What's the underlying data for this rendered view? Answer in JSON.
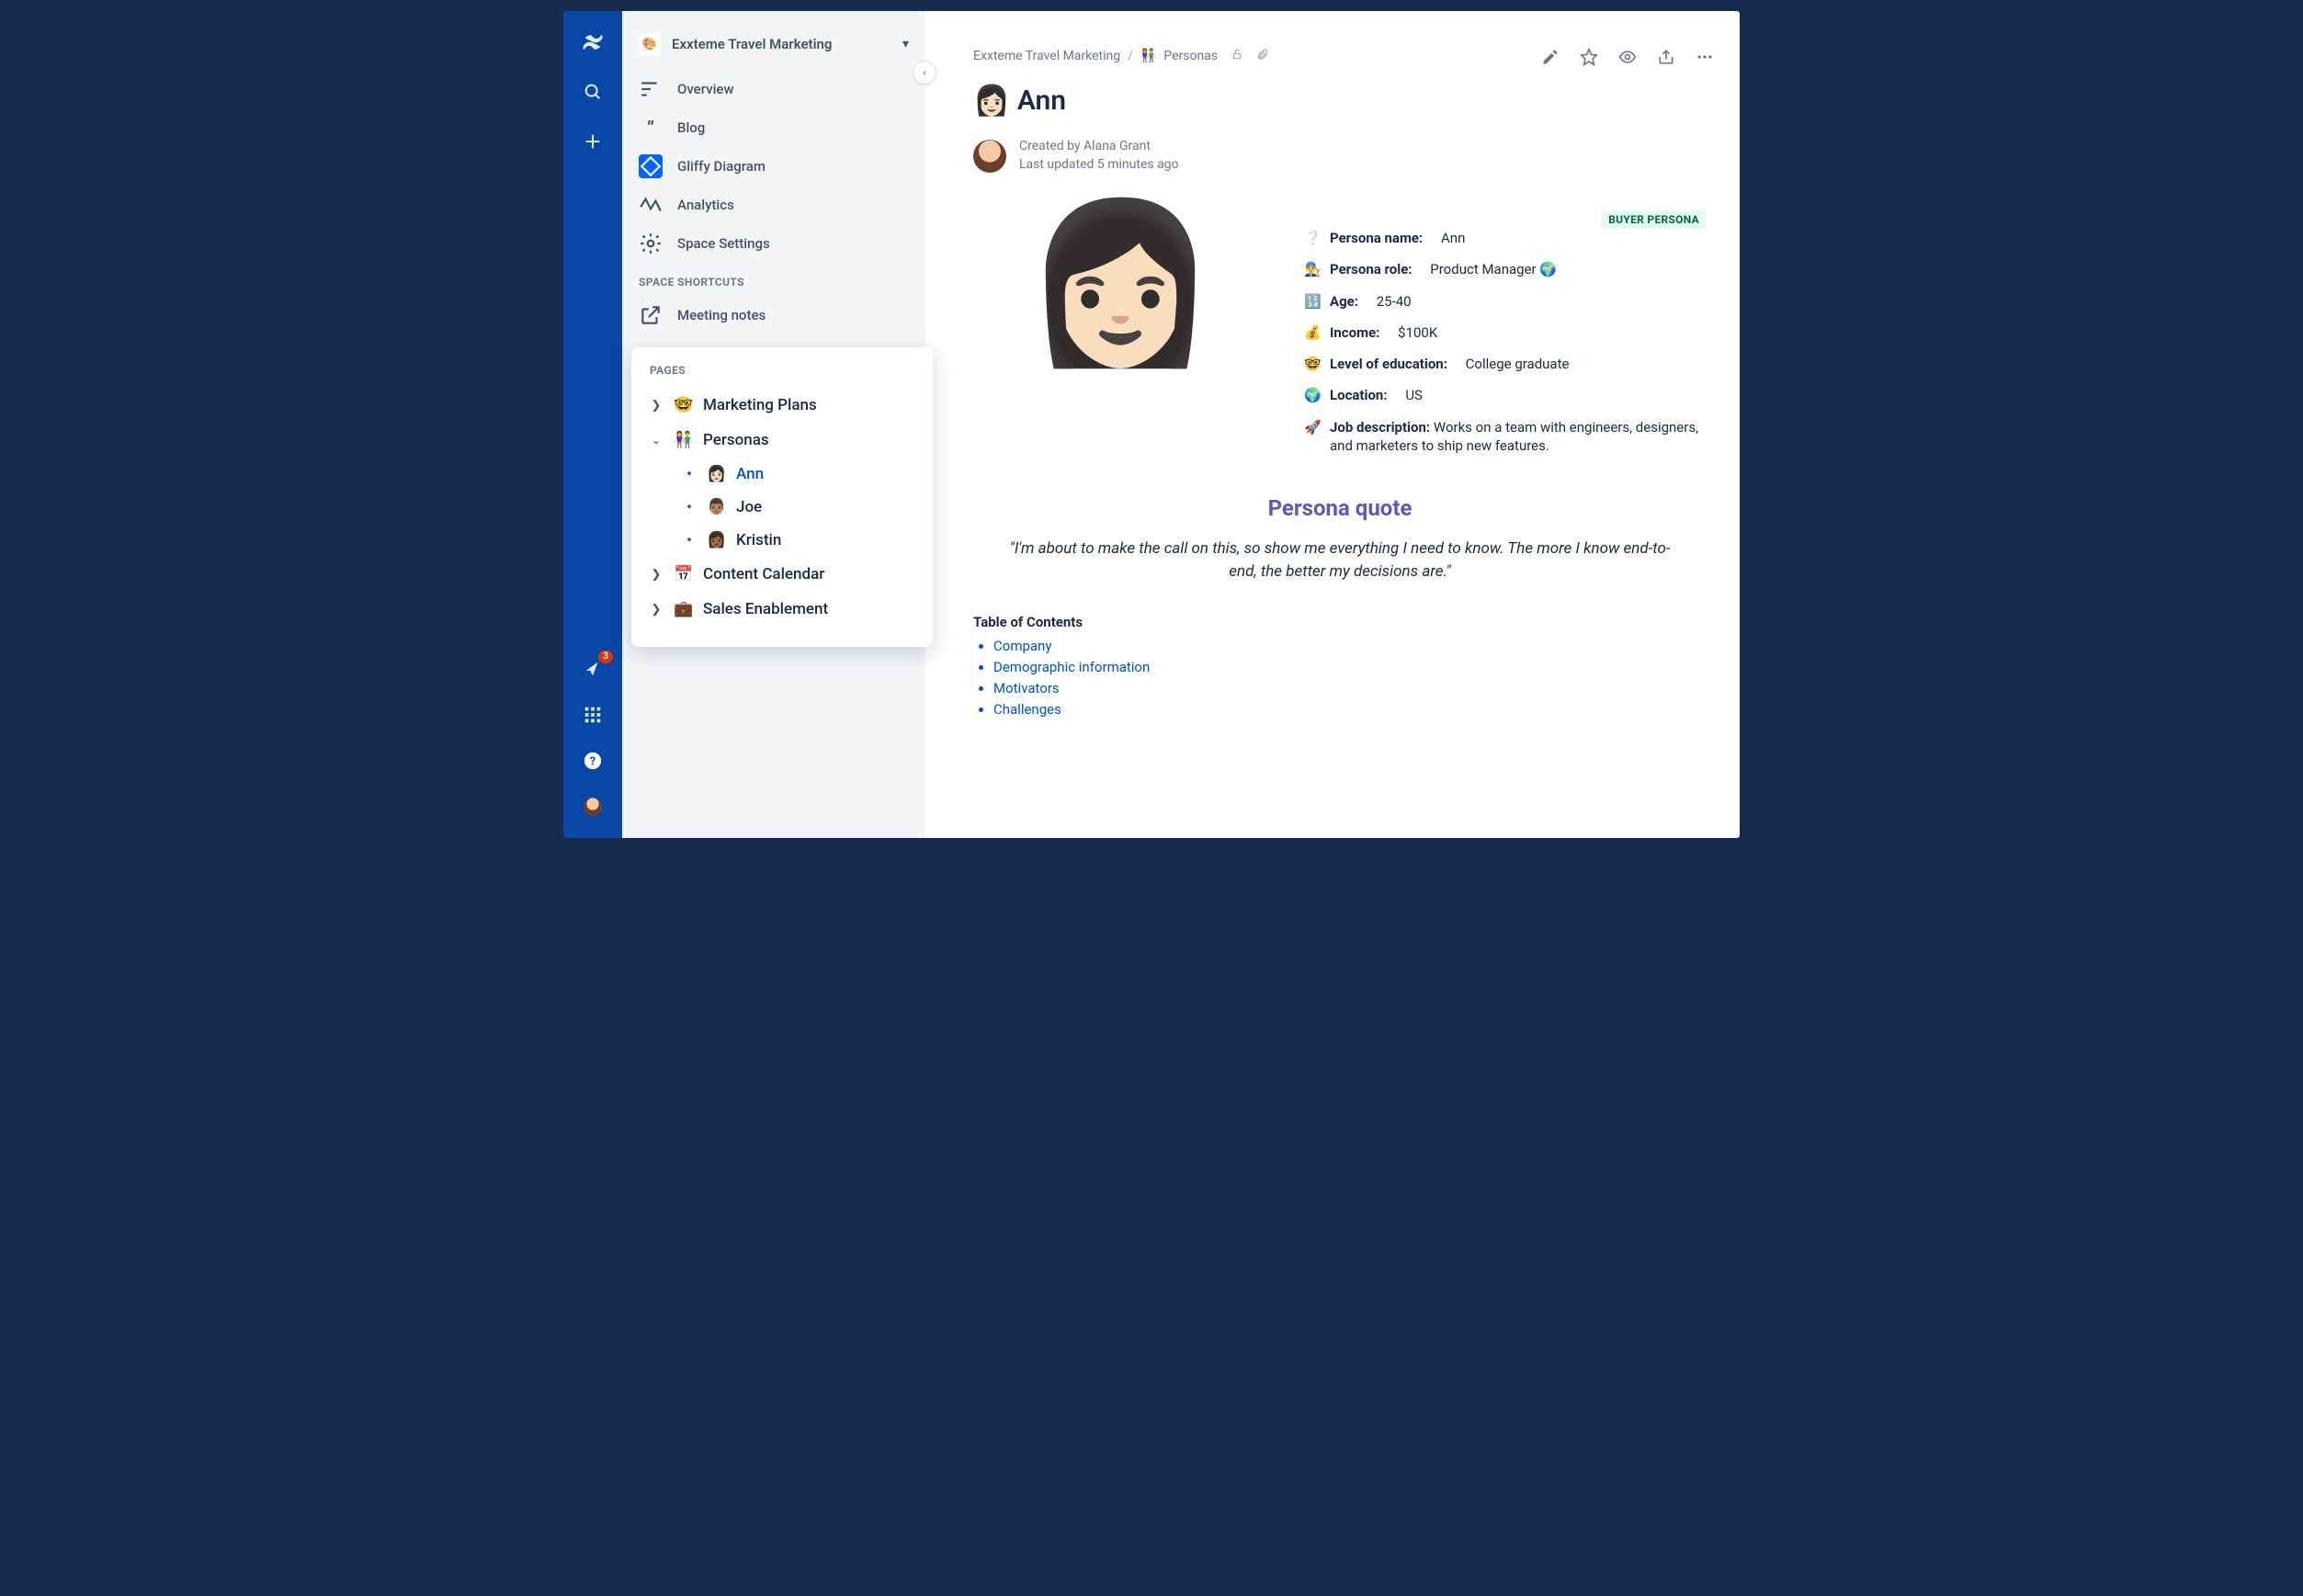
{
  "globalNav": {
    "notificationCount": "3"
  },
  "space": {
    "title": "Exxteme Travel Marketing",
    "logo": "🎨"
  },
  "sidebarNav": {
    "overview": "Overview",
    "blog": "Blog",
    "gliffy": "Gliffy Diagram",
    "analytics": "Analytics",
    "settings": "Space Settings"
  },
  "shortcuts": {
    "header": "SPACE SHORTCUTS",
    "meetingNotes": "Meeting notes"
  },
  "pages": {
    "header": "PAGES",
    "marketingPlans": {
      "label": "Marketing Plans",
      "emoji": "🤓"
    },
    "personas": {
      "label": "Personas",
      "emoji": "👫",
      "children": {
        "ann": {
          "label": "Ann",
          "emoji": "👩🏻"
        },
        "joe": {
          "label": "Joe",
          "emoji": "👨🏽"
        },
        "kristin": {
          "label": "Kristin",
          "emoji": "👩🏾"
        }
      }
    },
    "contentCalendar": {
      "label": "Content Calendar",
      "emoji": "📅"
    },
    "salesEnablement": {
      "label": "Sales Enablement",
      "emoji": "💼"
    }
  },
  "breadcrumbs": {
    "space": "Exxteme Travel Marketing",
    "page": "Personas",
    "emoji": "👫"
  },
  "pageHeader": {
    "emoji": "👩🏻",
    "title": "Ann",
    "createdByPrefix": "Created by",
    "author": "Alana Grant",
    "updated": "Last updated 5 minutes ago"
  },
  "persona": {
    "badge": "BUYER PERSONA",
    "avatarEmoji": "👩🏻",
    "fields": {
      "name": {
        "icon": "❔",
        "label": "Persona name:",
        "value": "Ann"
      },
      "role": {
        "icon": "👨‍🔧",
        "label": "Persona role:",
        "value": "Product Manager 🌍"
      },
      "age": {
        "icon": "🔢",
        "label": "Age:",
        "value": "25-40"
      },
      "income": {
        "icon": "💰",
        "label": "Income:",
        "value": "$100K"
      },
      "education": {
        "icon": "🤓",
        "label": "Level of education:",
        "value": "College graduate"
      },
      "location": {
        "icon": "🌍",
        "label": "Location:",
        "value": "US"
      },
      "job": {
        "icon": "🚀",
        "label": "Job description:",
        "value": "Works on a team with engineers, designers, and marketers to ship new features."
      }
    }
  },
  "quote": {
    "heading": "Persona quote",
    "text": "\"I'm about to make the call on this, so show me everything I need to know. The more I know end-to-end, the better my decisions are.\""
  },
  "toc": {
    "heading": "Table of Contents",
    "items": {
      "company": "Company",
      "demographic": "Demographic information",
      "motivators": "Motivators",
      "challenges": "Challenges"
    }
  }
}
